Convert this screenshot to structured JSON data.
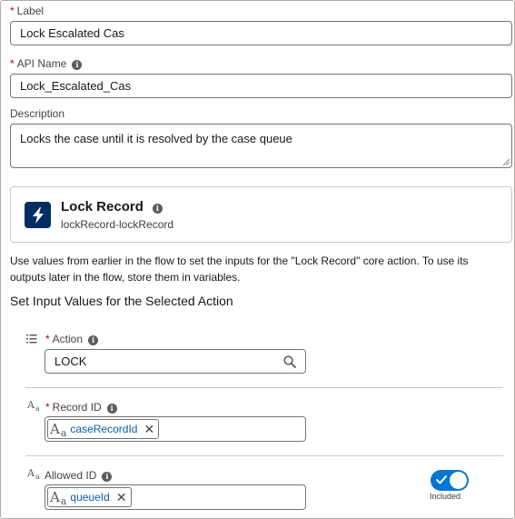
{
  "label_field": {
    "label": "Label",
    "value": "Lock Escalated Cas"
  },
  "api_name_field": {
    "label": "API Name",
    "value": "Lock_Escalated_Cas"
  },
  "description_field": {
    "label": "Description",
    "value": "Locks the case until it is resolved by the case queue"
  },
  "action_card": {
    "title": "Lock Record",
    "subtitle": "lockRecord-lockRecord"
  },
  "helper_text": "Use values from earlier in the flow to set the inputs for the \"Lock Record\" core action. To use its outputs later in the flow, store them in variables.",
  "section_title": "Set Input Values for the Selected Action",
  "inputs": {
    "action": {
      "label": "Action",
      "value": "LOCK",
      "icon": "list-icon"
    },
    "record_id": {
      "label": "Record ID",
      "pill": "caseRecordId",
      "icon": "text-type-icon"
    },
    "allowed_id": {
      "label": "Allowed ID",
      "pill": "queueId",
      "icon": "text-type-icon",
      "toggle_label": "Included",
      "toggle_on": true
    }
  },
  "colors": {
    "accent": "#0176d3",
    "required": "#ba0517",
    "icon_bg": "#032d60",
    "pill_text": "#0b5cab"
  }
}
